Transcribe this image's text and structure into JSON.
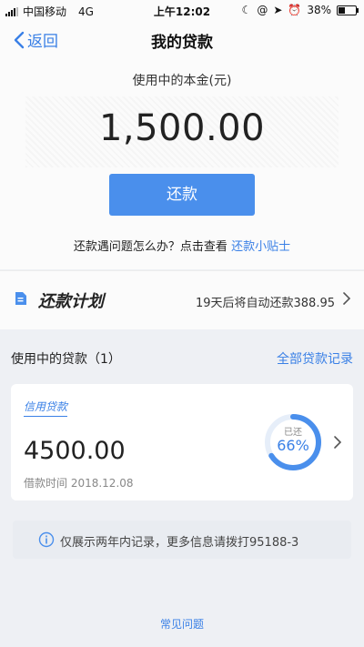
{
  "status_bar": {
    "carrier": "中国移动",
    "network": "4G",
    "time": "上午12:02",
    "battery": "38%",
    "battery_level": 0.38
  },
  "nav": {
    "back_label": "返回",
    "title": "我的贷款"
  },
  "principal": {
    "label": "使用中的本金(元)",
    "amount": "1,500.00"
  },
  "repay_button": "还款",
  "help": {
    "text": "还款遇问题怎么办？点击查看",
    "link": "还款小贴士"
  },
  "plan": {
    "title": "还款计划",
    "info": "19天后将自动还款388.95"
  },
  "loans": {
    "label": "使用中的贷款（1）",
    "all_link": "全部贷款记录"
  },
  "loan_card": {
    "type": "信用贷款",
    "amount": "4500.00",
    "date": "借款时间 2018.12.08",
    "repaid_label": "已还",
    "repaid_percent": "66%",
    "repaid_fraction": 0.66
  },
  "notice": "仅展示两年内记录，更多信息请拨打95188-3",
  "faq": "常见问题",
  "colors": {
    "accent": "#3a80e6",
    "button": "#4a8fec",
    "background": "#eef0f4"
  }
}
